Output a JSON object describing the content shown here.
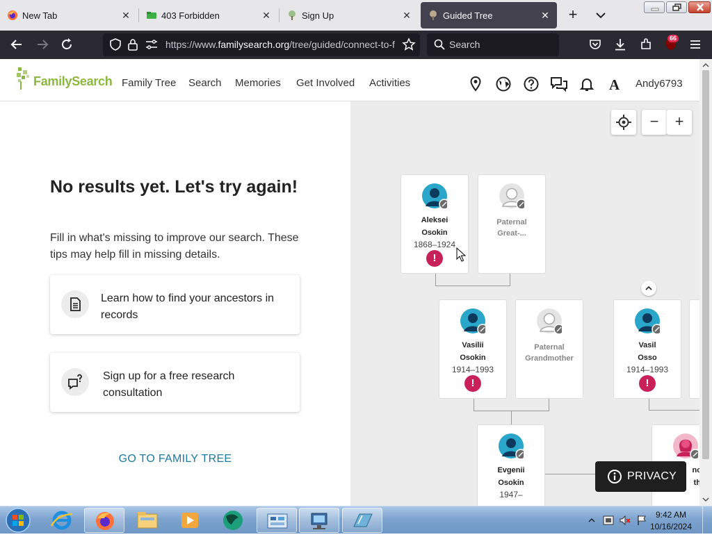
{
  "browser": {
    "tabs": [
      {
        "title": "New Tab",
        "icon": "firefox-icon"
      },
      {
        "title": "403 Forbidden",
        "icon": "green-folder-icon"
      },
      {
        "title": "Sign Up",
        "icon": "tree-icon"
      },
      {
        "title": "Guided Tree",
        "icon": "tree-icon",
        "active": true
      }
    ],
    "url_prefix": "https://www.",
    "url_host": "familysearch.org",
    "url_path": "/tree/guided/connect-to-f",
    "search_placeholder": "Search",
    "extension_badge": "66"
  },
  "site": {
    "logo_text": "FamilySearch",
    "nav": [
      "Family Tree",
      "Search",
      "Memories",
      "Get Involved",
      "Activities"
    ],
    "avatar_letter": "A",
    "username": "Andy6793"
  },
  "panel": {
    "heading": "No results yet. Let's try again!",
    "subtext": "Fill in what's missing to improve our search. These tips may help fill in missing details.",
    "tips": [
      {
        "label": "Learn how to find your ancestors in records",
        "icon": "document-icon"
      },
      {
        "label": "Sign up for a free research consultation",
        "icon": "chat-question-icon"
      }
    ],
    "go_to_tree": "GO TO FAMILY TREE"
  },
  "tree": {
    "persons": {
      "aleksei": {
        "first": "Aleksei",
        "last": "Osokin",
        "dates": "1868–1924"
      },
      "paternal_great": {
        "line1": "Paternal",
        "line2": "Great-..."
      },
      "vasilii": {
        "first": "Vasilii",
        "last": "Osokin",
        "dates": "1914–1993"
      },
      "paternal_grandmother": {
        "line1": "Paternal",
        "line2": "Grandmother"
      },
      "vasil": {
        "first": "Vasil",
        "last": "Osso",
        "dates": "1914–1993"
      },
      "evgenii": {
        "first": "Evgenii",
        "last": "Osokin",
        "dates": "1947–"
      },
      "unknown_mother": {
        "line1": "nowi",
        "line2": "ther"
      }
    },
    "privacy_label": "PRIVACY",
    "zoom_out": "−",
    "zoom_in": "+"
  },
  "taskbar": {
    "time": "9:42 AM",
    "date": "10/16/2024"
  },
  "colors": {
    "brand_green": "#8cb83f",
    "alert_red": "#c8215a",
    "link_blue": "#1a7aa0",
    "male_avatar": "#29a6c9",
    "female_avatar": "#c8215a"
  }
}
